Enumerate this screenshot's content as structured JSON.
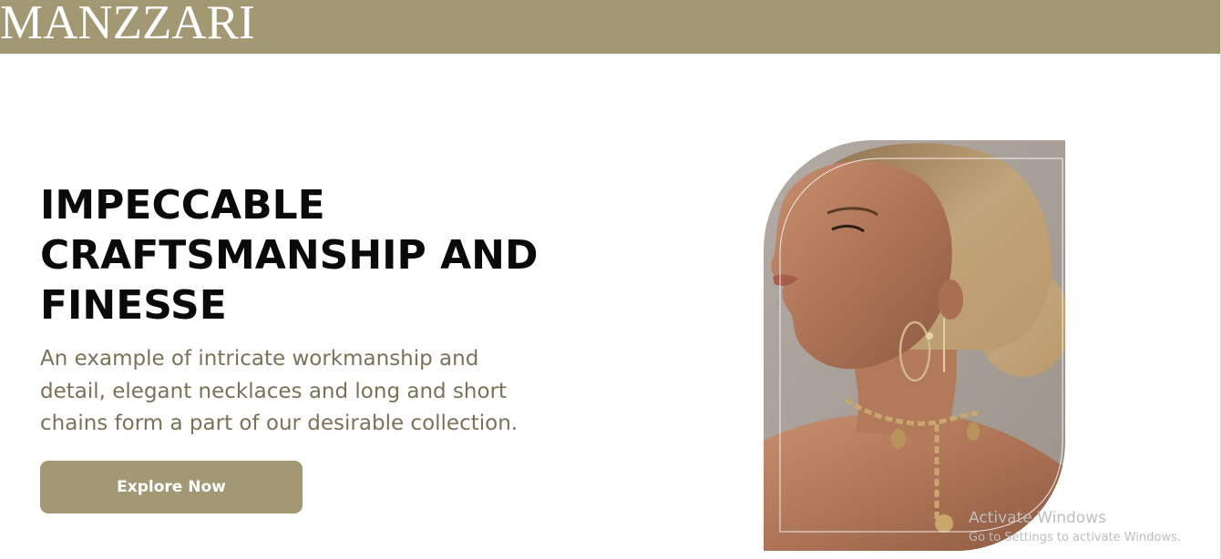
{
  "header": {
    "brand": "MANZZARI"
  },
  "hero": {
    "headline": "IMPECCABLE CRAFTSMANSHIP AND FINESSE",
    "description": "An example of intricate workmanship and detail, elegant necklaces and long and short chains form a part of our desirable collection.",
    "cta_label": "Explore Now"
  },
  "watermark": {
    "title": "Activate Windows",
    "subtitle": "Go to Settings to activate Windows."
  },
  "colors": {
    "accent": "#a39874",
    "headline": "#0a0a0a",
    "description": "#7a7157"
  }
}
